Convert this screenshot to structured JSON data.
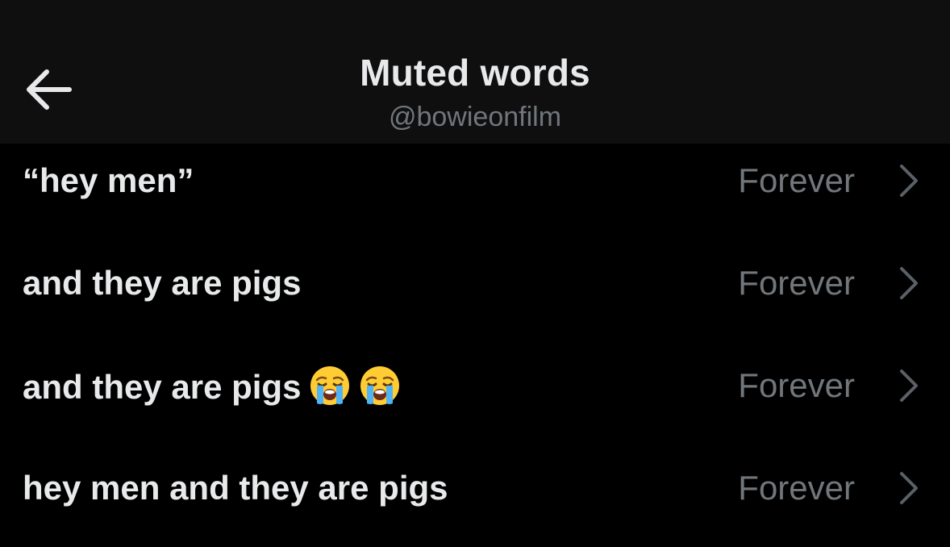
{
  "header": {
    "title": "Muted words",
    "handle": "@bowieonfilm",
    "back_icon": "arrow-left-icon"
  },
  "muted_words": [
    {
      "word": "“hey men”",
      "duration": "Forever"
    },
    {
      "word": "and they are pigs",
      "duration": "Forever"
    },
    {
      "word": "and they are pigs",
      "duration": "Forever",
      "emoji_count": 2,
      "emoji_icon": "loudly-crying-face-icon"
    },
    {
      "word": "hey men and they are pigs",
      "duration": "Forever"
    }
  ],
  "colors": {
    "background": "#000000",
    "header_background": "#0f0f10",
    "primary_text": "#e7e9ea",
    "secondary_text": "#71767b",
    "chevron": "#5b6066"
  }
}
